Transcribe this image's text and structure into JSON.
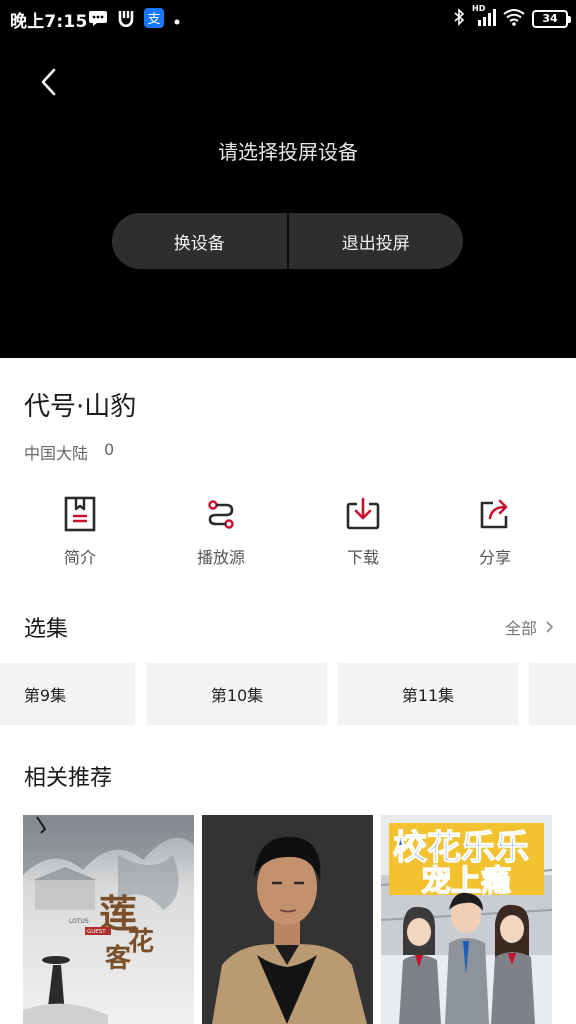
{
  "status_bar": {
    "time": "晚上7:15",
    "battery": "34",
    "network_label": "HD",
    "icons": [
      "message-icon",
      "shield-icon",
      "alipay-icon",
      "dot-icon",
      "bluetooth-icon",
      "signal-icon",
      "wifi-icon",
      "battery-icon"
    ]
  },
  "cast": {
    "title": "请选择投屏设备",
    "change_device_label": "换设备",
    "exit_cast_label": "退出投屏",
    "back_icon": "chevron-left-icon"
  },
  "show": {
    "title": "代号·山豹",
    "region": "中国大陆",
    "count": "0"
  },
  "actions": [
    {
      "label": "简介",
      "icon": "intro-icon"
    },
    {
      "label": "播放源",
      "icon": "source-icon"
    },
    {
      "label": "下载",
      "icon": "download-icon"
    },
    {
      "label": "分享",
      "icon": "share-icon"
    }
  ],
  "episodes_section": {
    "title": "选集",
    "all_label": "全部",
    "items": [
      "第9集",
      "第10集",
      "第11集",
      ""
    ]
  },
  "recommend_section": {
    "title": "相关推荐",
    "posters": [
      {
        "title_text": "莲花客",
        "subtitle_text": "LOTUS GUEST"
      },
      {
        "title_text": ""
      },
      {
        "title_text": "校花乐乐宠上瘾"
      }
    ]
  },
  "colors": {
    "accent": "#c8102e",
    "icon_dark": "#2a2a2a",
    "cast_bg": "#000000",
    "button_bg": "#2e2e2e"
  }
}
